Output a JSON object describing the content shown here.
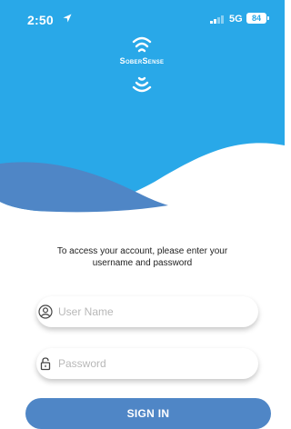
{
  "status_bar": {
    "time": "2:50",
    "network": "5G",
    "battery": "84"
  },
  "brand": {
    "name": "SoberSense",
    "subtitle": "",
    "colors": {
      "sky": "#29a8e8",
      "wave": "#4f86c6",
      "button": "#4f86c6"
    }
  },
  "login": {
    "prompt": "To access your account, please enter your username and password",
    "username_placeholder": "User Name",
    "password_placeholder": "Password",
    "sign_in_label": "SIGN IN"
  },
  "icons": {
    "location": "location-arrow-icon",
    "signal": "cellular-signal-icon",
    "user": "user-circle-icon",
    "lock": "lock-icon",
    "logo": "sound-wave-logo-icon"
  }
}
